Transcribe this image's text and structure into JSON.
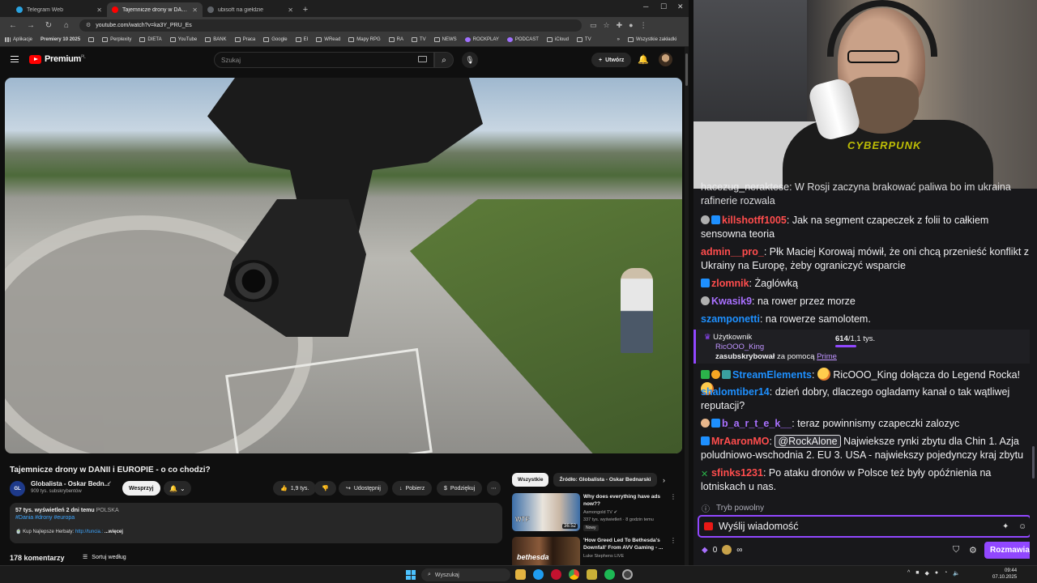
{
  "browser": {
    "tabs": [
      {
        "label": "Telegram Web",
        "color": "#2aa3e0",
        "active": false
      },
      {
        "label": "Tajemnicze drony w DANII i ...",
        "color": "#ff0000",
        "active": true
      },
      {
        "label": "ubisoft na giełdzie",
        "color": "#5f6368",
        "active": false
      }
    ],
    "url": "youtube.com/watch?v=ka3Y_PRU_Es",
    "bookmarks": [
      "Aplikacje",
      "Premiery 10 2025",
      "Perplexity",
      "DIETA",
      "YouTube",
      "BANK",
      "Praca",
      "Google",
      "EI",
      "WRead",
      "Mapy RPG",
      "RA",
      "TV",
      "NEWS",
      "ROCKPLAY",
      "PODCAST",
      "iCloud",
      "TV"
    ],
    "all_bookmarks": "Wszystkie zakładki"
  },
  "youtube": {
    "logo": "Premium",
    "logo_sup": "PL",
    "search_placeholder": "Szukaj",
    "create_label": "Utwórz",
    "video_title": "Tajemnicze drony w DANII i EUROPIE - o co chodzi?",
    "channel": {
      "avatar_text": "GL",
      "name": "Globalista - Oskar Bedn...",
      "subs": "909 tys. subskrybentów",
      "support_label": "Wesprzyj"
    },
    "actions": {
      "likes": "1,9 tys.",
      "share": "Udostępnij",
      "download": "Pobierz",
      "thanks": "Podziękuj"
    },
    "description": {
      "views_date": "57 tys. wyświetleń  2 dni temu",
      "country": "POLSKA",
      "tags": "#Dania #drony #europa",
      "promo": "Kup Najlepsze Herbaty:",
      "promo_link": "http://tuncia.:",
      "more": "...więcej"
    },
    "comments": "178 komentarzy",
    "sort": "Sortuj według",
    "chips": [
      "Wszystkie",
      "Źródło: Globalista - Oskar Bednarski"
    ],
    "recommendations": [
      {
        "title": "Why does everything have ads now??",
        "channel": "Asmongold TV",
        "meta": "337 tys. wyświetleń · 8 godzin temu",
        "badge": "Nowy",
        "duration": "36:52",
        "thumb_text": "WTF"
      },
      {
        "title": "'How Greed Led To Bethesda's Downfall' From AVV Gaming - ...",
        "channel": "Luke Stephens LIVE",
        "meta": "",
        "badge": "",
        "duration": "",
        "thumb_text": "bethesda"
      }
    ]
  },
  "webcam": {
    "shirt_text": "CYBERPUNK"
  },
  "chat": {
    "top_partial": "hacezug_neraktese: W Rosji zaczyna brakować paliwa bo im ukraina rafinerie rozwala",
    "messages": [
      {
        "user": "killshotff1005",
        "color": "#ff4d4d",
        "text": "Jak na segment czapeczek z folii to całkiem sensowna teoria"
      },
      {
        "user": "admin__pro_",
        "color": "#ff4d4d",
        "text": "Płk Maciej Korowaj mówił, że oni chcą przenieść konflikt z Ukrainy na Europę, żeby ograniczyć wsparcie"
      },
      {
        "user": "zlomnik",
        "color": "#ff4d4d",
        "text": "Żaglówką"
      },
      {
        "user": "Kwasik9",
        "color": "#a970ff",
        "text": "na rower przez morze"
      },
      {
        "user": "szamponetti",
        "color": "#1e90ff",
        "text": "na rowerze samolotem."
      }
    ],
    "sub_notice": {
      "label": "Użytkownik",
      "user": "RicOOO_King",
      "action": "zasubskrybował",
      "via": "za pomocą",
      "prime": "Prime",
      "count": "614",
      "total": "/1,1 tys."
    },
    "messages2": [
      {
        "user": "StreamElements",
        "color": "#1e90ff",
        "text": "RicOOO_King dołącza do Legend Rocka!"
      },
      {
        "user": "shalomtiber14",
        "color": "#1e90ff",
        "text": "dzień dobry, dlaczego ogladamy kanał o tak wątliwej reputacji?"
      },
      {
        "user": "b_a_r_t_e_k__",
        "color": "#a970ff",
        "text": "teraz powinnismy czapeczki zalozyc"
      },
      {
        "user": "MrAaronMO",
        "color": "#ff4d4d",
        "mention": "@RockAlone",
        "text": "Najwieksze rynki zbytu dla Chin 1. Azja poludniowo-wschodnia 2. EU 3. USA - najwiekszy pojedynczy kraj zbytu"
      },
      {
        "user": "sfinks1231",
        "color": "#ff4d4d",
        "text": "Po ataku dronów w Polsce też były opóźnienia na lotniskach u nas."
      }
    ],
    "slow_mode": "Tryb powolny",
    "input_placeholder": "Wyślij wiadomość",
    "points": "0",
    "send_label": "Rozmawiaj"
  },
  "taskbar": {
    "search": "Wyszukaj",
    "time": "09:44",
    "date": "07.10.2025"
  }
}
